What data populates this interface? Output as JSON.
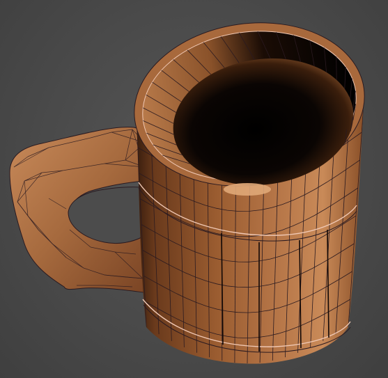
{
  "viewport": {
    "background": "#4a4a4a"
  },
  "model": {
    "object_icon": "wooden-tankard-mesh",
    "material_color": "#b07044",
    "material_highlight": "#d9a070",
    "material_shadow": "#4a2814",
    "wire_color": "#2a1a20",
    "wire_light_color": "#f0c8b4"
  }
}
